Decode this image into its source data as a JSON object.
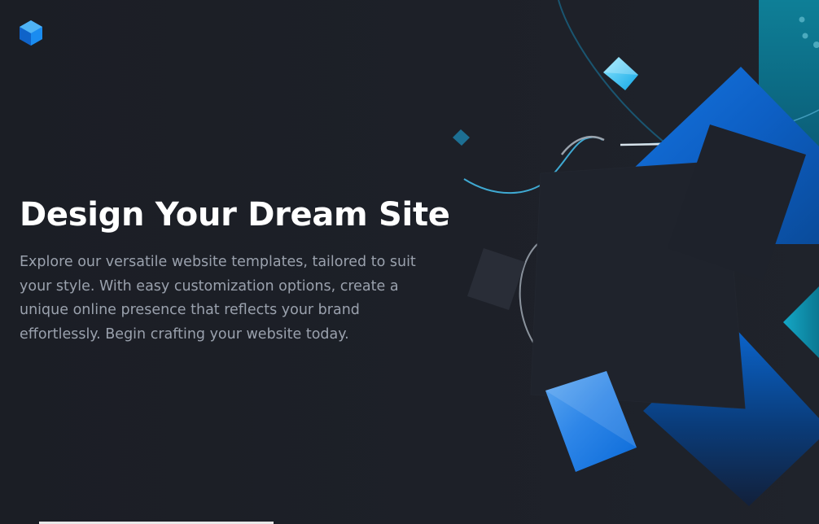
{
  "hero": {
    "title": "Design Your Dream Site",
    "description": "Explore our versatile website templates, tailored to suit your style. With easy customization options, create a unique online presence that reflects your brand effortlessly. Begin crafting your website today."
  },
  "brand": {
    "logo_icon": "cube-logo-icon"
  },
  "colors": {
    "background": "#1c1f26",
    "accent_blue": "#0b6bd8",
    "accent_cyan": "#22c1ee",
    "teal": "#0f8aa3",
    "title_text": "#ffffff",
    "body_text": "#9aa1ad"
  }
}
